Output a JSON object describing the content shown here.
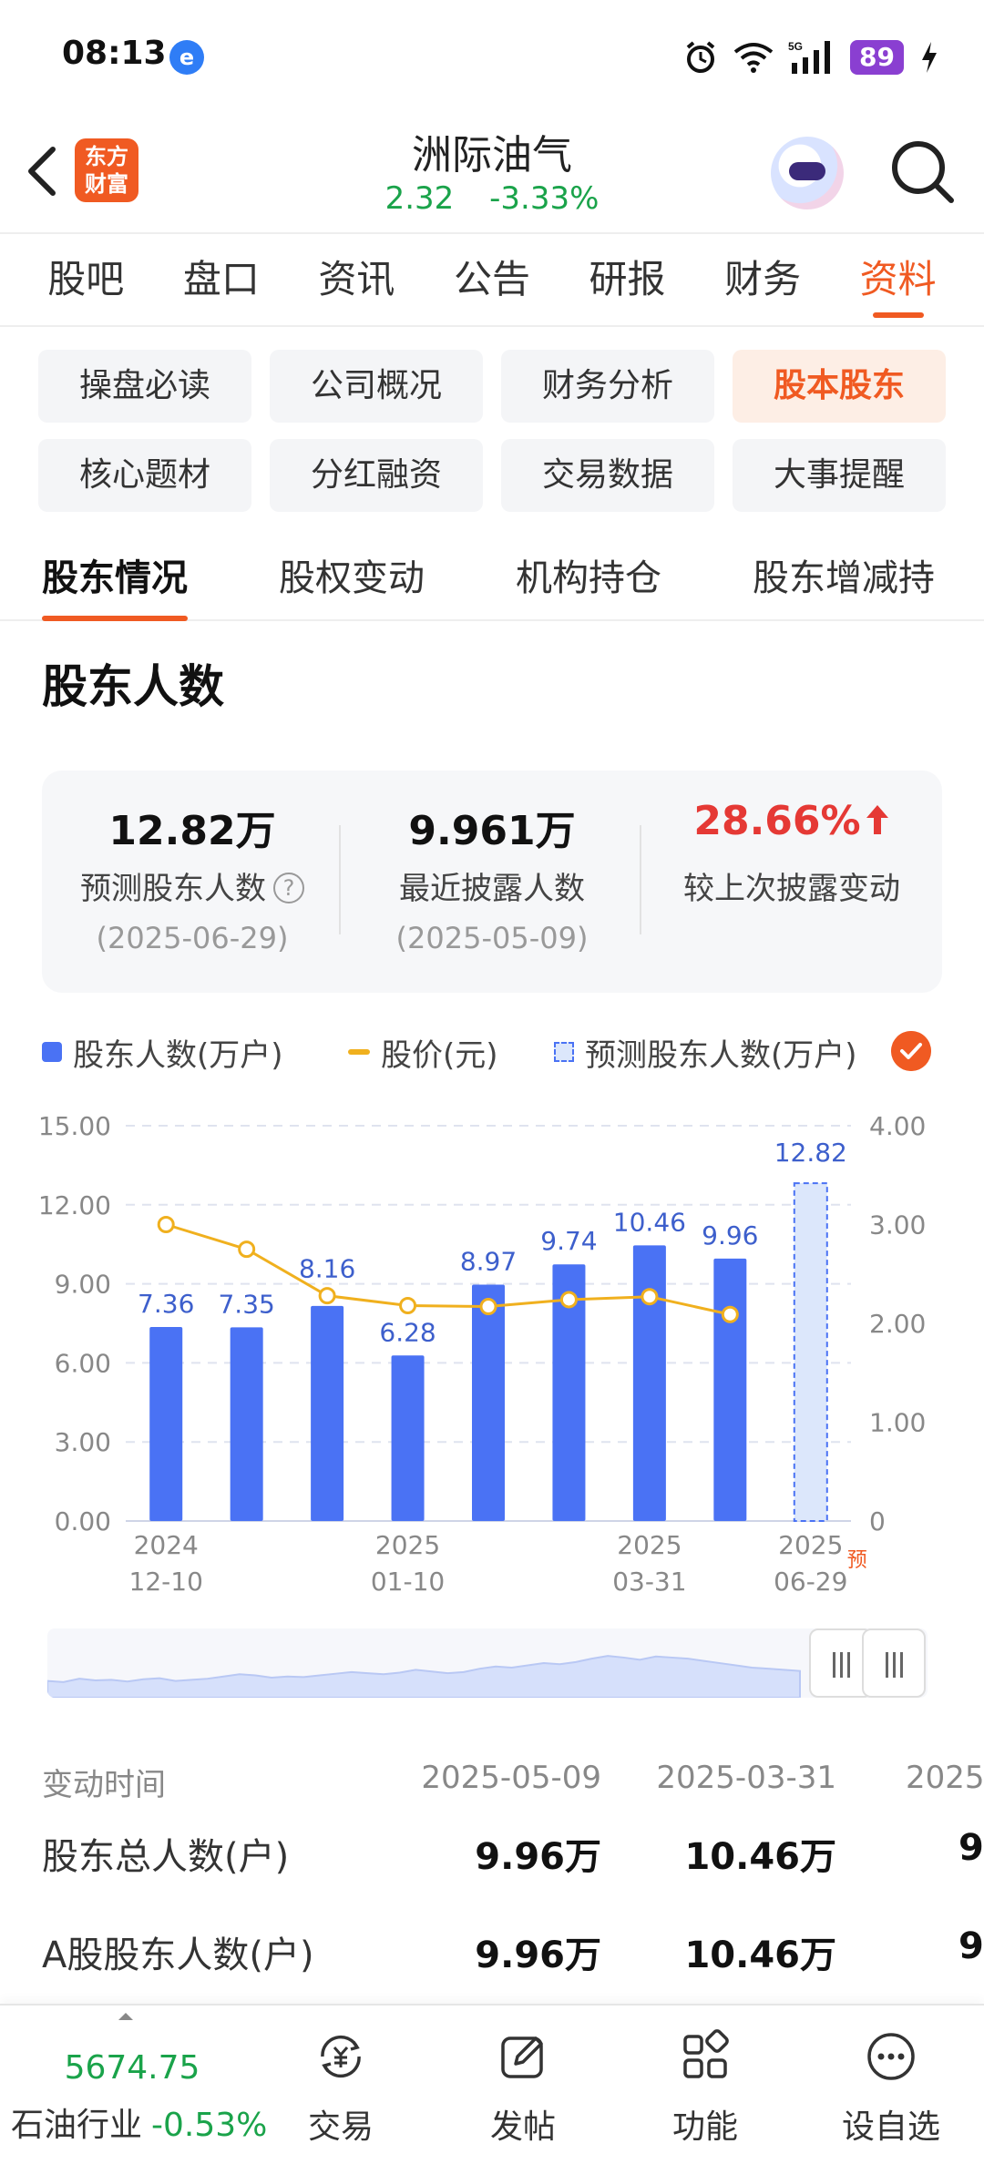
{
  "status_bar": {
    "time": "08:13",
    "app_icon_glyph": "e",
    "network": "5G",
    "battery": "89",
    "icons": [
      "alarm-icon",
      "wifi-icon",
      "signal-icon",
      "battery-icon",
      "charging-icon"
    ]
  },
  "header": {
    "brand_logo": "东方财富",
    "stock_name": "洲际油气",
    "price": "2.32",
    "change_pct": "-3.33%",
    "price_color": "#1aa34a"
  },
  "main_tabs": [
    {
      "label": "股吧",
      "active": false
    },
    {
      "label": "盘口",
      "active": false
    },
    {
      "label": "资讯",
      "active": false
    },
    {
      "label": "公告",
      "active": false
    },
    {
      "label": "研报",
      "active": false
    },
    {
      "label": "财务",
      "active": false
    },
    {
      "label": "资料",
      "active": true
    }
  ],
  "chips": [
    {
      "label": "操盘必读",
      "active": false
    },
    {
      "label": "公司概况",
      "active": false
    },
    {
      "label": "财务分析",
      "active": false
    },
    {
      "label": "股本股东",
      "active": true
    },
    {
      "label": "核心题材",
      "active": false
    },
    {
      "label": "分红融资",
      "active": false
    },
    {
      "label": "交易数据",
      "active": false
    },
    {
      "label": "大事提醒",
      "active": false
    }
  ],
  "sub_tabs": [
    {
      "label": "股东情况",
      "active": true
    },
    {
      "label": "股权变动",
      "active": false
    },
    {
      "label": "机构持仓",
      "active": false
    },
    {
      "label": "股东增减持",
      "active": false
    }
  ],
  "section_title": "股东人数",
  "stats": [
    {
      "value": "12.82万",
      "label": "预测股东人数",
      "date": "(2025-06-29)"
    },
    {
      "value": "9.961万",
      "label": "最近披露人数",
      "date": "(2025-05-09)"
    },
    {
      "value": "28.66%",
      "label": "较上次披露变动",
      "date": ""
    }
  ],
  "legend": {
    "bar": "股东人数(万户)",
    "line": "股价(元)",
    "predicted": "预测股东人数(万户)"
  },
  "colors": {
    "accent": "#f05a22",
    "bar": "#4a72f4",
    "line": "#f0b01e",
    "up": "#e53935",
    "down": "#1aa34a"
  },
  "chart_data": {
    "type": "bar",
    "categories": [
      "2024-12-10",
      "",
      "",
      "2025-01-10",
      "",
      "",
      "2025-03-31",
      "",
      "2025-06-29"
    ],
    "x_tick_labels": [
      {
        "index": 0,
        "year": "2024",
        "date": "12-10"
      },
      {
        "index": 3,
        "year": "2025",
        "date": "01-10"
      },
      {
        "index": 6,
        "year": "2025",
        "date": "03-31"
      },
      {
        "index": 8,
        "year": "2025",
        "date": "06-29"
      }
    ],
    "predicted_marker": "预",
    "series": [
      {
        "name": "股东人数(万户)",
        "type": "bar",
        "values": [
          7.36,
          7.35,
          8.16,
          6.28,
          8.97,
          9.74,
          10.46,
          9.96,
          null
        ]
      },
      {
        "name": "预测股东人数(万户)",
        "type": "bar-predicted",
        "values": [
          null,
          null,
          null,
          null,
          null,
          null,
          null,
          null,
          12.82
        ]
      },
      {
        "name": "股价(元)",
        "type": "line",
        "axis": "right",
        "values": [
          3.0,
          2.75,
          2.28,
          2.18,
          2.17,
          2.24,
          2.27,
          2.09,
          null
        ]
      }
    ],
    "y_left": {
      "ticks": [
        "0.00",
        "3.00",
        "6.00",
        "9.00",
        "12.00",
        "15.00"
      ],
      "ylim": [
        0,
        15
      ]
    },
    "y_right": {
      "ticks": [
        "0",
        "1.00",
        "2.00",
        "3.00",
        "4.00"
      ],
      "ylim": [
        0,
        4
      ]
    },
    "overview_values": [
      0.3,
      0.28,
      0.34,
      0.31,
      0.32,
      0.29,
      0.33,
      0.35,
      0.3,
      0.32,
      0.34,
      0.38,
      0.42,
      0.4,
      0.36,
      0.38,
      0.37,
      0.4,
      0.43,
      0.46,
      0.44,
      0.42,
      0.45,
      0.5,
      0.47,
      0.44,
      0.46,
      0.52,
      0.56,
      0.54,
      0.58,
      0.62,
      0.6,
      0.64,
      0.7,
      0.75,
      0.72,
      0.68,
      0.74,
      0.72,
      0.7,
      0.66,
      0.62,
      0.58,
      0.54,
      0.52,
      0.5,
      0.48
    ],
    "grid": true
  },
  "table": {
    "header": {
      "label": "变动时间",
      "cols": [
        "2025-05-09",
        "2025-03-31",
        "2025-"
      ]
    },
    "rows": [
      {
        "label": "股东总人数(户)",
        "cols": [
          "9.96万",
          "10.46万",
          "9."
        ]
      },
      {
        "label": "A股股东人数(户)",
        "cols": [
          "9.96万",
          "10.46万",
          "9."
        ]
      }
    ]
  },
  "bottom_bar": {
    "industry_value": "5674.75",
    "industry_name": "石油行业",
    "industry_change": "-0.53%",
    "nav": [
      {
        "label": "交易",
        "icon": "trade-icon"
      },
      {
        "label": "发帖",
        "icon": "post-icon"
      },
      {
        "label": "功能",
        "icon": "apps-icon"
      },
      {
        "label": "设自选",
        "icon": "more-icon"
      }
    ]
  }
}
